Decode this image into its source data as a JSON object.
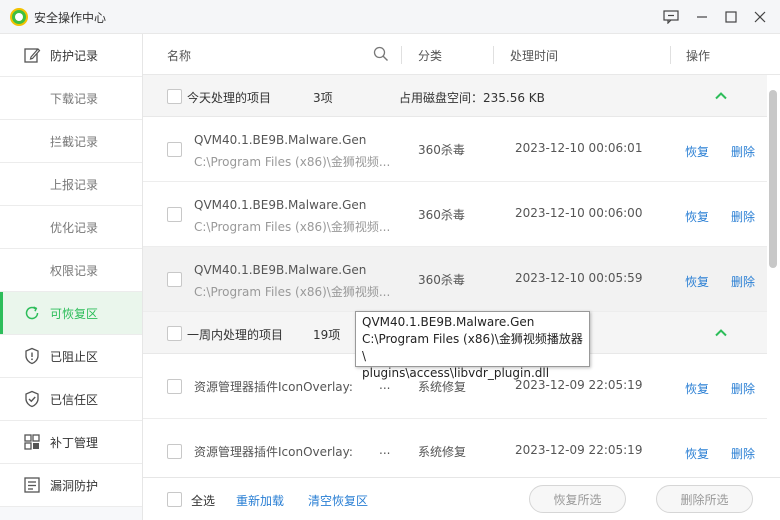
{
  "window": {
    "title": "安全操作中心"
  },
  "sidebar": {
    "items": [
      {
        "label": "防护记录",
        "icon": "edit-icon"
      },
      {
        "label": "下载记录"
      },
      {
        "label": "拦截记录"
      },
      {
        "label": "上报记录"
      },
      {
        "label": "优化记录"
      },
      {
        "label": "权限记录"
      },
      {
        "label": "可恢复区",
        "icon": "restore-icon"
      },
      {
        "label": "已阻止区",
        "icon": "blocked-shield-icon"
      },
      {
        "label": "已信任区",
        "icon": "trusted-shield-icon"
      },
      {
        "label": "补丁管理",
        "icon": "patch-grid-icon"
      },
      {
        "label": "漏洞防护",
        "icon": "vulnerability-icon"
      }
    ]
  },
  "header": {
    "name": "名称",
    "category": "分类",
    "time": "处理时间",
    "action": "操作"
  },
  "groups": [
    {
      "name": "今天处理的项目",
      "count": "3项",
      "size": "占用磁盘空间：235.56 KB",
      "rows": [
        {
          "name": "QVM40.1.BE9B.Malware.Gen",
          "path": "C:\\Program Files (x86)\\金狮视频...",
          "category": "360杀毒",
          "time": "2023-12-10 00:06:01",
          "restore": "恢复",
          "delete": "删除"
        },
        {
          "name": "QVM40.1.BE9B.Malware.Gen",
          "path": "C:\\Program Files (x86)\\金狮视频...",
          "category": "360杀毒",
          "time": "2023-12-10 00:06:00",
          "restore": "恢复",
          "delete": "删除"
        },
        {
          "name": "QVM40.1.BE9B.Malware.Gen",
          "path": "C:\\Program Files (x86)\\金狮视频...",
          "category": "360杀毒",
          "time": "2023-12-10 00:05:59",
          "restore": "恢复",
          "delete": "删除"
        }
      ]
    },
    {
      "name": "一周内处理的项目",
      "count": "19项",
      "rows": [
        {
          "name": "资源管理器插件IconOverlay:",
          "dots": "...",
          "category": "系统修复",
          "time": "2023-12-09 22:05:19",
          "restore": "恢复",
          "delete": "删除"
        },
        {
          "name": "资源管理器插件IconOverlay:",
          "dots": "...",
          "category": "系统修复",
          "time": "2023-12-09 22:05:19",
          "restore": "恢复",
          "delete": "删除"
        }
      ]
    }
  ],
  "tooltip": {
    "line1": "QVM40.1.BE9B.Malware.Gen",
    "line2": "C:\\Program Files (x86)\\金狮视频播放器\\",
    "line3": "plugins\\access\\libvdr_plugin.dll"
  },
  "footer": {
    "select_all": "全选",
    "reload": "重新加载",
    "clear": "清空恢复区",
    "restore_selected": "恢复所选",
    "delete_selected": "删除所选"
  },
  "colors": {
    "accent": "#2dbd5a",
    "link": "#2a7fd4"
  }
}
